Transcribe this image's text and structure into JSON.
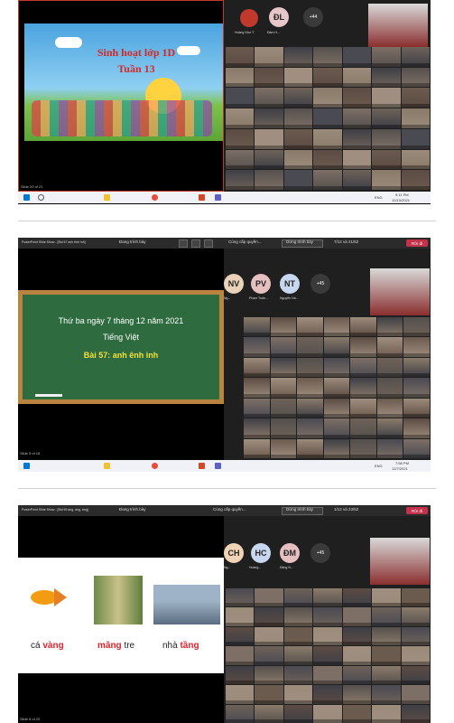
{
  "screen1": {
    "slide_title_line1": "Sinh hoạt lớp 1D",
    "slide_title_line2": "Tuần 13",
    "slide_status": "Slide 20 of 21",
    "avatar_initials": "ĐL",
    "avatar_names": [
      "Hoàng Như Ý",
      "Đàm H..."
    ],
    "more_count": "+44",
    "clock_time": "9:11 PM",
    "clock_date": "12/10/2021",
    "lang": "ENG"
  },
  "screen2": {
    "app_title": "PowerPoint Slide Show - [Bài 57 anh ênh inh]",
    "presenting_label": "Đang trình bày",
    "share_label": "Cùng cấp quyền...",
    "stop_label": "Dừng trình bày",
    "slide_counter": "7/12 và 21/52",
    "leave_label": "Rời đi",
    "board_line1": "Thứ ba ngày 7 tháng 12 năm 2021",
    "board_line2": "Tiếng Việt",
    "board_line3": "Bài 57: anh  ênh  inh",
    "avatar_initials": [
      "NV",
      "PV",
      "NT"
    ],
    "avatar_names": [
      "Ng...",
      "Phạm Tuấn...",
      "Nguyễn Hà..."
    ],
    "more_count": "+45",
    "slide_status": "Slide 5 of 18",
    "clock_time": "7:58 PM",
    "clock_date": "12/7/2021",
    "lang": "ENG"
  },
  "screen3": {
    "app_title": "PowerPoint Slide Show - [Bài 59 ang, âng, ăng]",
    "presenting_label": "Đang trình bày",
    "share_label": "Cùng cấp quyền...",
    "stop_label": "Dừng trình bày",
    "slide_counter": "1/12 và 23/52",
    "leave_label": "Rời đi",
    "avatar_initials": [
      "CH",
      "HC",
      "ĐM"
    ],
    "avatar_names": [
      "Ng...",
      "Hoàng...",
      "Đặng N..."
    ],
    "more_count": "+45",
    "word1_a": "cá ",
    "word1_b": "vàng",
    "word2_a": "măng",
    "word2_b": " tre",
    "word3_a": "nhà ",
    "word3_b": "tầng",
    "slide_status": "Slide 6 of 20"
  },
  "colors": {
    "teams_bg": "#1f1f1f",
    "leave_red": "#c4314b",
    "title_red": "#d62828",
    "board_green": "#2e6b3f",
    "board_frame": "#b98440",
    "highlight_yellow": "#f2e13a"
  }
}
